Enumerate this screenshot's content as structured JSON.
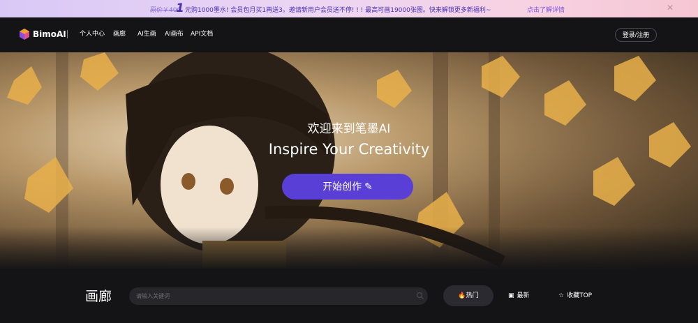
{
  "promo": {
    "old_price": "原价￥400",
    "big_number": "1",
    "text": "元购1000墨水! 会员包月买1再送3。邀请新用户会员送不停! ! ! 最高可画19000张图。快来解锁更多新福利~",
    "link": "点击了解详情",
    "close_icon": "close-icon"
  },
  "nav": {
    "brand": "BimoAI",
    "items": [
      "个人中心",
      "画廊",
      "AI生画",
      "AI画布",
      "API文档"
    ],
    "login": "登录/注册"
  },
  "hero": {
    "title": "欢迎来到笔墨AI",
    "subtitle": "Inspire Your Creativity",
    "cta": "开始创作 ✎"
  },
  "gallery": {
    "title": "画廊",
    "search_placeholder": "请输入关键词",
    "tabs": [
      {
        "icon": "fire-icon",
        "label": "热门"
      },
      {
        "icon": "bookmark-icon",
        "label": "最新"
      },
      {
        "icon": "star-icon",
        "label": "收藏TOP"
      }
    ]
  },
  "colors": {
    "accent": "#5a3fd6",
    "background": "#141416"
  }
}
